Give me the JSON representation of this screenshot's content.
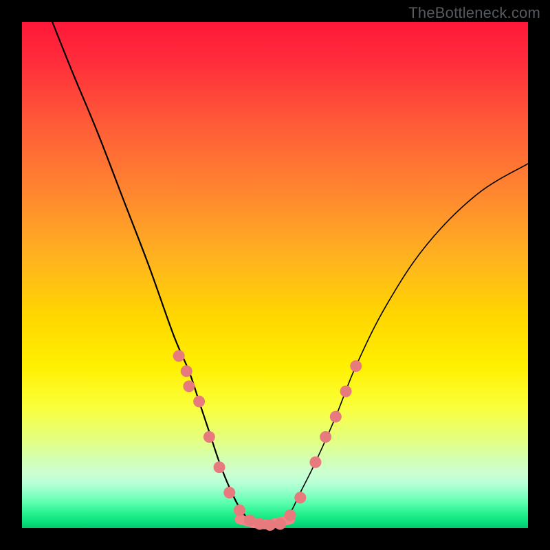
{
  "attribution": "TheBottleneck.com",
  "colors": {
    "page_bg": "#000000",
    "curve": "#000000",
    "dot": "#e77a7d",
    "bottom_stroke": "#ef8587",
    "gradient_top": "#ff173a",
    "gradient_bottom": "#04c86e"
  },
  "chart_data": {
    "type": "line",
    "title": "",
    "xlabel": "",
    "ylabel": "",
    "xlim": [
      0,
      100
    ],
    "ylim": [
      0,
      100
    ],
    "series": [
      {
        "name": "bottleneck-curve",
        "x": [
          6,
          10,
          15,
          20,
          25,
          30,
          33,
          35,
          37,
          39,
          41,
          43,
          45,
          47,
          49,
          51,
          53,
          55,
          58,
          62,
          66,
          72,
          80,
          90,
          100
        ],
        "y": [
          100,
          90,
          78,
          65,
          52,
          38,
          31,
          25,
          19,
          13,
          8,
          4,
          1.5,
          0.5,
          0.5,
          1,
          3,
          7,
          13,
          22,
          32,
          44,
          56,
          66,
          72
        ]
      }
    ],
    "highlight_dots": {
      "name": "sampled-points",
      "x": [
        31,
        32.5,
        33,
        35,
        37,
        39,
        41,
        43,
        45,
        47,
        49,
        51,
        53,
        55,
        58,
        60,
        62,
        64,
        66
      ],
      "y": [
        34,
        31,
        28,
        25,
        18,
        12,
        7,
        3.5,
        1.5,
        0.8,
        0.6,
        0.8,
        2.5,
        6,
        13,
        18,
        22,
        27,
        32
      ]
    },
    "flat_bottom": {
      "x_from": 43,
      "x_to": 53,
      "y": 0.7
    }
  }
}
